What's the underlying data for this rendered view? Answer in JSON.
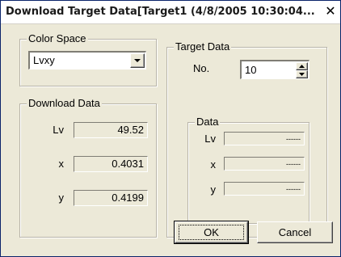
{
  "window": {
    "title": "Download Target Data[Target1 (4/8/2005 10:30:04...",
    "close_glyph": "✕"
  },
  "color_space": {
    "legend": "Color Space",
    "selected": "Lvxy"
  },
  "target_data": {
    "legend": "Target Data",
    "no_label": "No.",
    "no_value": "10",
    "data": {
      "legend": "Data",
      "rows": [
        {
          "label": "Lv",
          "value": "------"
        },
        {
          "label": "x",
          "value": "------"
        },
        {
          "label": "y",
          "value": "------"
        }
      ]
    }
  },
  "download_data": {
    "legend": "Download Data",
    "rows": [
      {
        "label": "Lv",
        "value": "49.52"
      },
      {
        "label": "x",
        "value": "0.4031"
      },
      {
        "label": "y",
        "value": "0.4199"
      }
    ]
  },
  "buttons": {
    "ok": "OK",
    "cancel": "Cancel"
  }
}
